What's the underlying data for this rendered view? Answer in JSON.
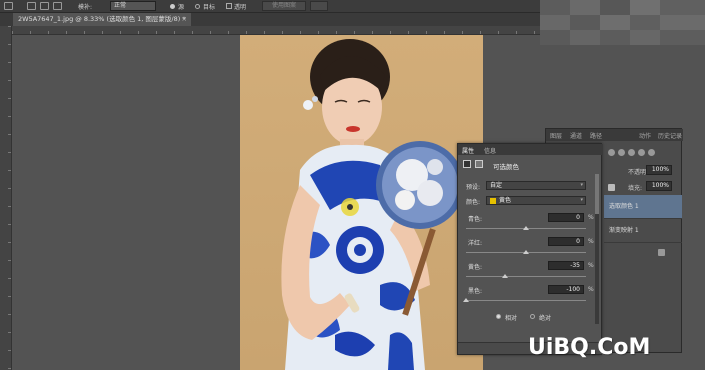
{
  "options_bar": {
    "sample_label": "取样",
    "mode_label": "模补:",
    "mode_value": "正常",
    "radio_source_label": "源",
    "radio_target_label": "目标",
    "transparent_label": "透明",
    "use_pattern_button": "使用图案"
  },
  "document": {
    "tab_title": "2W5A7647_1.jpg @ 8.33% (选取颜色 1, 图层蒙版/8) *",
    "close_symbol": "×"
  },
  "properties": {
    "tabs": [
      "属性",
      "信息"
    ],
    "title": "可选颜色",
    "preset_label": "预设:",
    "preset_value": "自定",
    "colors_label": "颜色:",
    "colors_value": "黄色",
    "swatch_color": "#e6c100",
    "sliders": [
      {
        "label": "青色:",
        "value": "0",
        "unit": "%",
        "level": 0
      },
      {
        "label": "洋红:",
        "value": "0",
        "unit": "%",
        "level": 0
      },
      {
        "label": "黄色:",
        "value": "-35",
        "unit": "%",
        "level": -35
      },
      {
        "label": "黑色:",
        "value": "-100",
        "unit": "%",
        "level": -100
      }
    ],
    "relative_label": "相对",
    "absolute_label": "绝对"
  },
  "layers": {
    "tabs": [
      "图层",
      "通道",
      "路径",
      "动作",
      "历史记录"
    ],
    "opacity_label": "不透明度:",
    "opacity_value": "100%",
    "fill_label": "填充:",
    "fill_value": "100%",
    "rows": [
      {
        "label": "选取颜色 1",
        "selected": true
      },
      {
        "label": "渐变映射 1",
        "selected": false
      }
    ]
  },
  "watermark": "UiBQ.CoM"
}
